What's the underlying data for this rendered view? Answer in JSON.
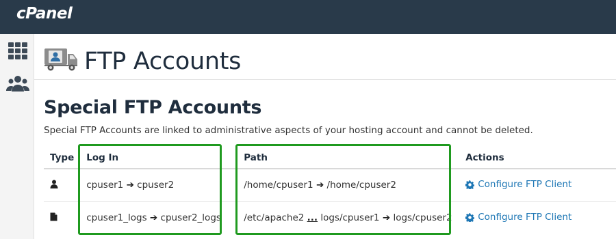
{
  "app": {
    "logo": "cPanel"
  },
  "sidebar": {
    "items": [
      {
        "icon": "grid-icon"
      },
      {
        "icon": "users-icon"
      }
    ]
  },
  "page": {
    "title": "FTP Accounts",
    "header_icon": "ftp-truck-icon"
  },
  "special": {
    "title": "Special FTP Accounts",
    "description": "Special FTP Accounts are linked to administrative aspects of your hosting account and cannot be deleted."
  },
  "table": {
    "headers": {
      "type": "Type",
      "login": "Log In",
      "path": "Path",
      "actions": "Actions"
    },
    "rows": [
      {
        "type_icon": "user-icon",
        "login_from": "cpuser1",
        "login_to": "cpuser2",
        "path_from": "/home/cpuser1",
        "path_ellipsis": "",
        "path_from_rest": "",
        "path_to": "/home/cpuser2",
        "action": "Configure FTP Client"
      },
      {
        "type_icon": "file-icon",
        "login_from": "cpuser1_logs",
        "login_to": "cpuser2_logs",
        "path_from": "/etc/apache2",
        "path_ellipsis": "...",
        "path_from_rest": "logs/cpuser1",
        "path_to": "logs/cpuser2",
        "action": "Configure FTP Client"
      }
    ]
  },
  "colors": {
    "topbar": "#293a4a",
    "highlight": "#1f9a1f",
    "link": "#1e77b5"
  }
}
